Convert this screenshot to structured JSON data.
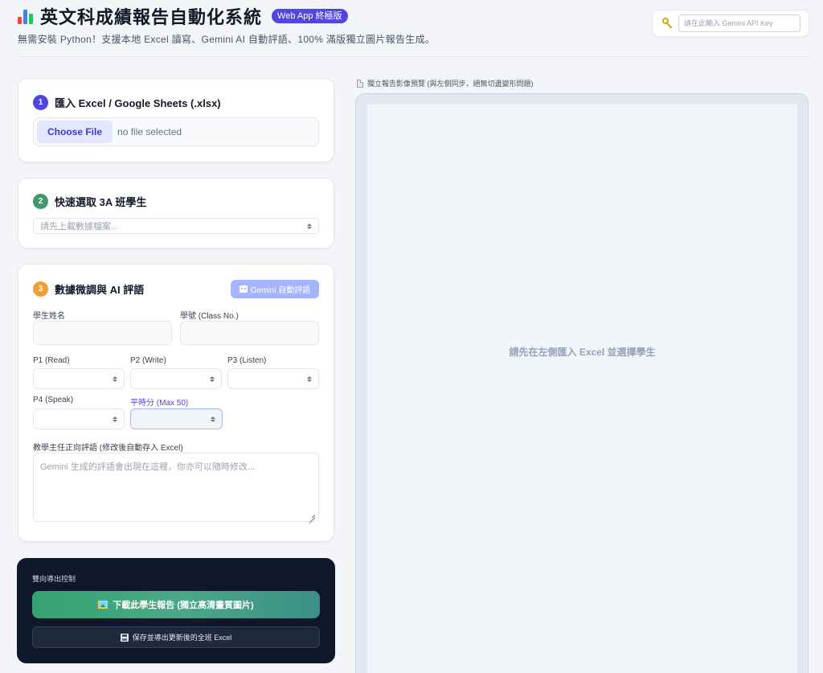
{
  "header": {
    "icon": "bar-chart-icon",
    "title": "英文科成績報告自動化系統",
    "badge": "Web App 終極版",
    "subtitle": "無需安裝 Python！支援本地 Excel 讀寫、Gemini AI 自動評語、100% 滿版獨立圖片報告生成。",
    "api_key_icon": "key-icon",
    "api_key_placeholder": "請在此輸入 Gemini API Key"
  },
  "step1": {
    "number": "1",
    "title": "匯入 Excel / Google Sheets (.xlsx)",
    "choose_label": "Choose File",
    "file_status": "no file selected",
    "color": "#4f46e5"
  },
  "step2": {
    "number": "2",
    "title": "快速選取 3A 班學生",
    "select_placeholder": "請先上載數據檔案...",
    "color": "#3f9a6b"
  },
  "step3": {
    "number": "3",
    "title": "數據微調與 AI 評語",
    "ai_button": "Gemini 自動評語",
    "name_label": "學生姓名",
    "class_label": "學號 (Class No.)",
    "p1_label": "P1 (Read)",
    "p2_label": "P2 (Write)",
    "p3_label": "P3 (Listen)",
    "p4_label": "P4 (Speak)",
    "avg_label": "平時分 (Max 50)",
    "comment_label": "教學主任正向評語 (修改後自動存入 Excel)",
    "comment_placeholder": "Gemini 生成的評語會出現在這裡，你亦可以隨時修改...",
    "color": "#f0a030"
  },
  "export": {
    "label": "雙向導出控制",
    "download_button": "下載此學生報告 (獨立高清畫質圖片)",
    "save_button": "保存並導出更新後的全班 Excel"
  },
  "preview": {
    "label": "獨立報告影像預覽 (與左側同步，絕無切邊變形問題)",
    "placeholder": "請先在左側匯入 Excel 並選擇學生"
  }
}
